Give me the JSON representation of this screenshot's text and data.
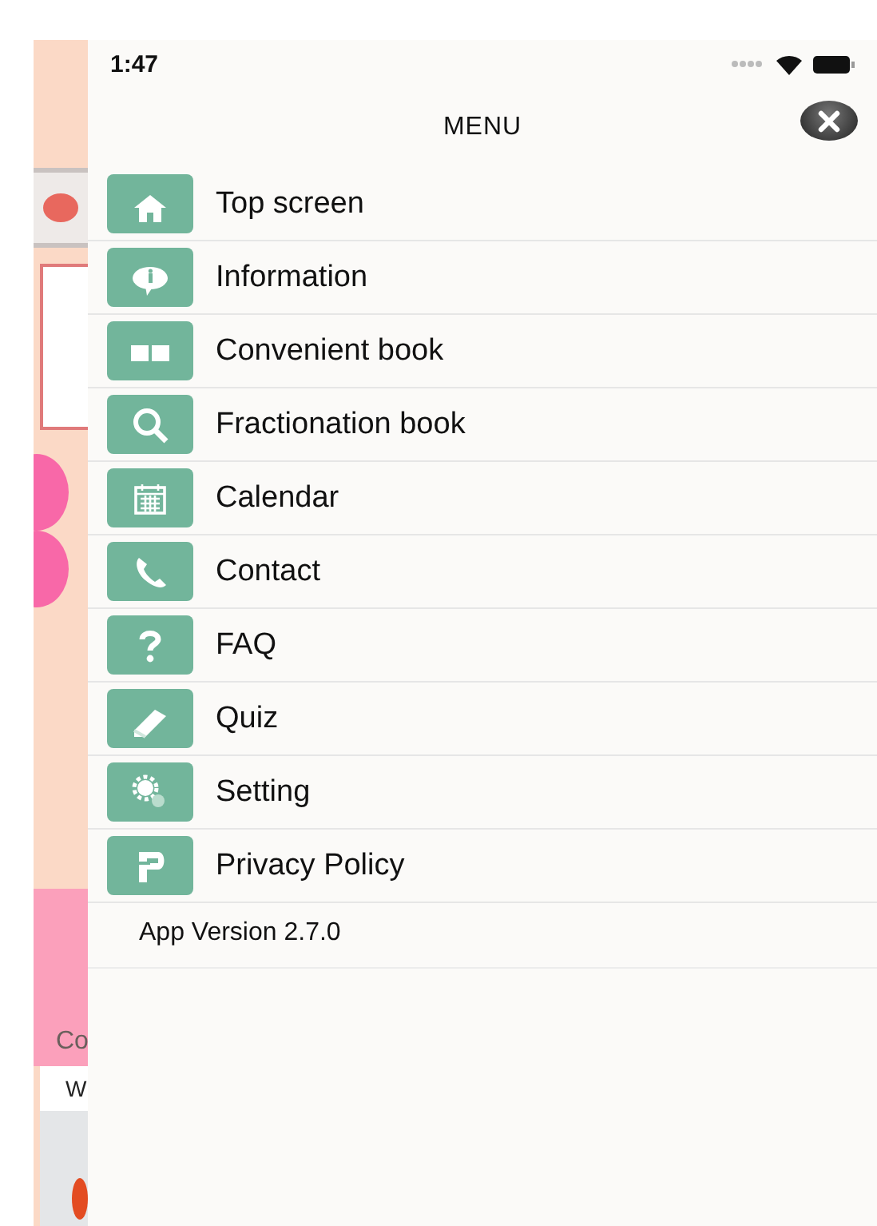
{
  "status_bar": {
    "time": "1:47"
  },
  "menu": {
    "title": "MENU",
    "items": [
      {
        "label": "Top screen"
      },
      {
        "label": "Information"
      },
      {
        "label": "Convenient book"
      },
      {
        "label": "Fractionation book"
      },
      {
        "label": "Calendar"
      },
      {
        "label": "Contact"
      },
      {
        "label": "FAQ"
      },
      {
        "label": "Quiz"
      },
      {
        "label": "Setting"
      },
      {
        "label": "Privacy Policy"
      }
    ],
    "version": "App Version 2.7.0"
  },
  "background": {
    "footer_fragment": "Co",
    "weekday_fragment": "W"
  }
}
